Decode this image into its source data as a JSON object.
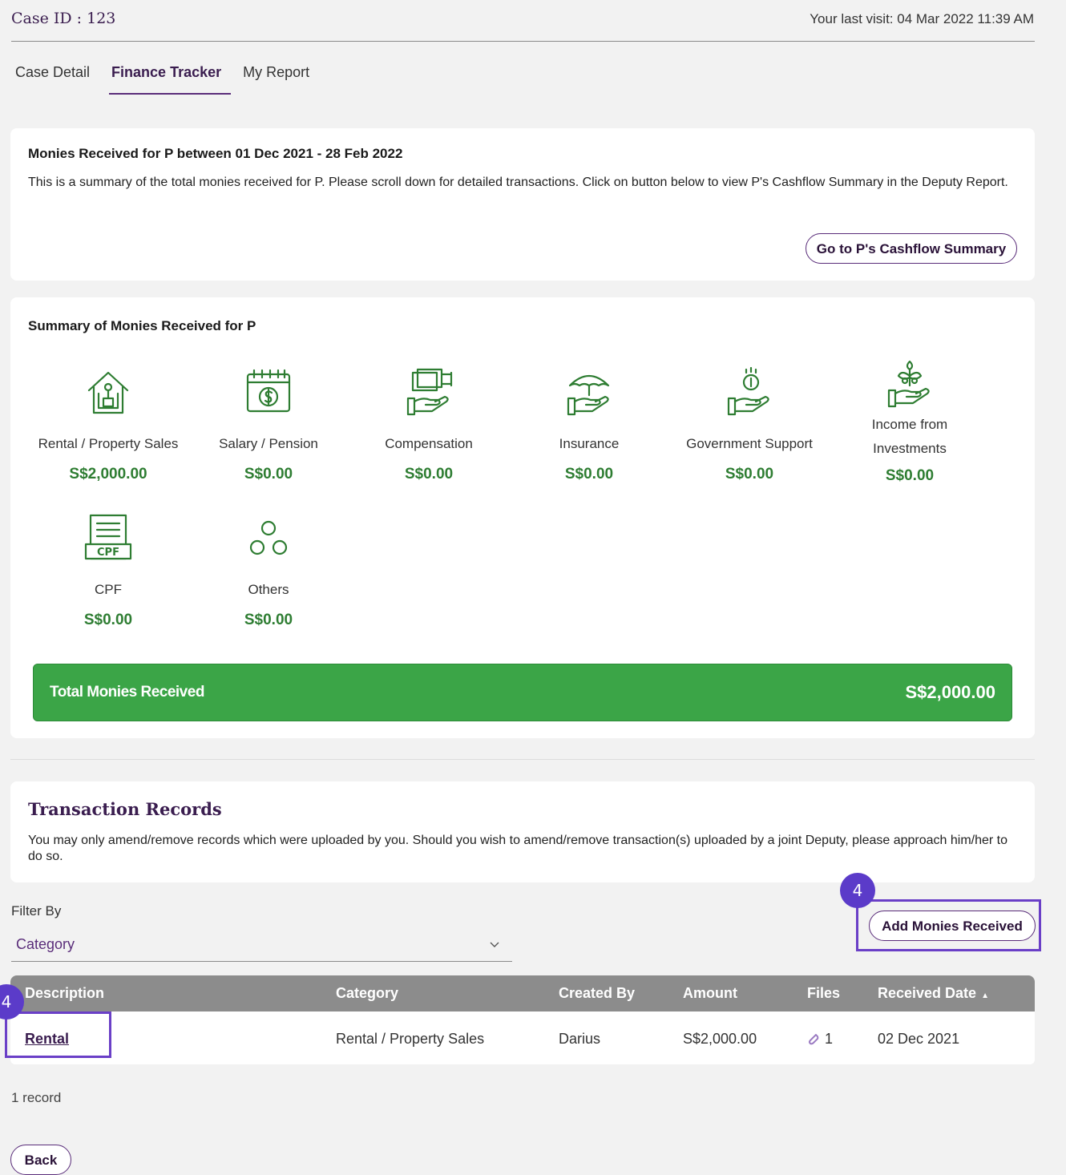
{
  "header": {
    "case_id": "Case ID : 123",
    "last_visit": "Your last visit: 04 Mar 2022 11:39 AM"
  },
  "tabs": [
    {
      "label": "Case Detail",
      "active": false
    },
    {
      "label": "Finance Tracker",
      "active": true
    },
    {
      "label": "My Report",
      "active": false
    }
  ],
  "monies_card": {
    "title": "Monies Received for P between 01 Dec 2021 - 28 Feb 2022",
    "description": "This is a summary of the total monies received for P. Please scroll down for detailed transactions. Click on button below to view P's Cashflow Summary in the Deputy Report.",
    "cashflow_button": "Go to P's Cashflow Summary"
  },
  "summary": {
    "title": "Summary of Monies Received for P",
    "items": [
      {
        "label": "Rental / Property Sales",
        "value": "S$2,000.00",
        "icon": "house-icon"
      },
      {
        "label": "Salary / Pension",
        "value": "S$0.00",
        "icon": "calendar-dollar-icon"
      },
      {
        "label": "Compensation",
        "value": "S$0.00",
        "icon": "cash-hand-icon"
      },
      {
        "label": "Insurance",
        "value": "S$0.00",
        "icon": "umbrella-hand-icon"
      },
      {
        "label": "Government Support",
        "value": "S$0.00",
        "icon": "coin-hand-icon"
      },
      {
        "label": "Income from Investments",
        "value": "S$0.00",
        "icon": "plant-hand-icon"
      },
      {
        "label": "CPF",
        "value": "S$0.00",
        "icon": "cpf-document-icon",
        "icon_text": "CPF"
      },
      {
        "label": "Others",
        "value": "S$0.00",
        "icon": "circles-icon"
      }
    ],
    "total_label": "Total Monies Received",
    "total_value": "S$2,000.00"
  },
  "transactions": {
    "title": "Transaction Records",
    "description": "You may only amend/remove records which were uploaded by you. Should you wish to amend/remove transaction(s) uploaded by a joint Deputy, please approach him/her to do so.",
    "filter_label": "Filter By",
    "filter_value": "Category",
    "add_button": "Add Monies Received",
    "columns": [
      "Description",
      "Category",
      "Created By",
      "Amount",
      "Files",
      "Received Date"
    ],
    "rows": [
      {
        "description": "Rental",
        "category": "Rental / Property Sales",
        "created_by": "Darius",
        "amount": "S$2,000.00",
        "files": "1",
        "received_date": "02 Dec 2021"
      }
    ],
    "record_count": "1 record",
    "back_button": "Back"
  },
  "annotations": {
    "badge_add": "4",
    "badge_rental": "4",
    "highlight_color": "#6a3fc7"
  },
  "colors": {
    "accent_purple": "#5a2d7a",
    "money_green": "#2e7d32",
    "total_bar_green": "#3ba547",
    "table_header_gray": "#8c8c8c"
  }
}
